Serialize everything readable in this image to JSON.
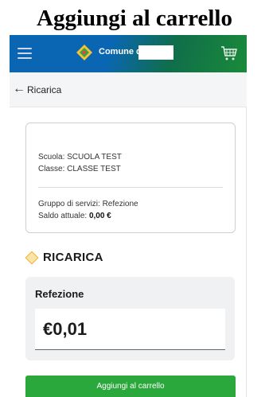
{
  "caption": "Aggiungi al carrello",
  "header": {
    "brand_text": "Comune di",
    "colors": {
      "blue": "#0a66b2",
      "green": "#1a8a3a"
    },
    "icons": [
      "menu-icon",
      "municipality-logo-icon",
      "cart-icon"
    ]
  },
  "nav": {
    "back_arrow": "←",
    "back_label": "Ricarica"
  },
  "info": {
    "school": "Scuola: SCUOLA TEST",
    "class": "Classe: CLASSE TEST",
    "service_group": "Gruppo di servizi: Refezione",
    "balance_label": "Saldo attuale: ",
    "balance_value": "0,00 €"
  },
  "section": {
    "title": "RICARICA"
  },
  "amount": {
    "label": "Refezione",
    "value": "€0,01"
  },
  "actions": {
    "add_to_cart_label": "Aggiungi al carrello",
    "button_color": "#2ba83c"
  }
}
